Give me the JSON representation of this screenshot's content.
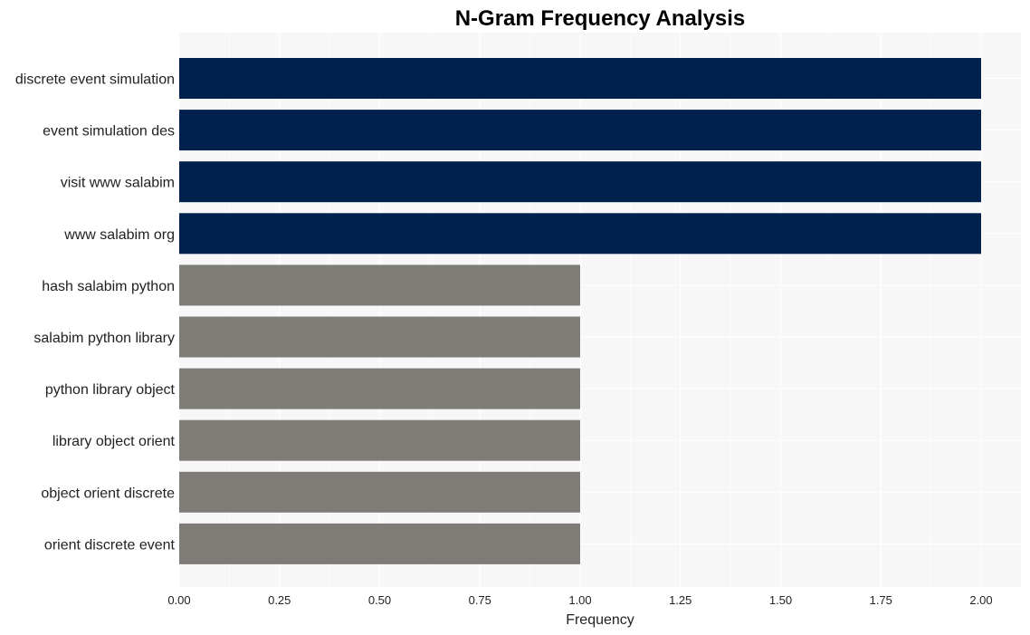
{
  "chart_data": {
    "type": "bar",
    "orientation": "horizontal",
    "title": "N-Gram Frequency Analysis",
    "xlabel": "Frequency",
    "ylabel": "",
    "categories": [
      "discrete event simulation",
      "event simulation des",
      "visit www salabim",
      "www salabim org",
      "hash salabim python",
      "salabim python library",
      "python library object",
      "library object orient",
      "object orient discrete",
      "orient discrete event"
    ],
    "values": [
      2,
      2,
      2,
      2,
      1,
      1,
      1,
      1,
      1,
      1
    ],
    "xlim": [
      0,
      2.1
    ],
    "xticks": [
      0,
      0.25,
      0.5,
      0.75,
      1.0,
      1.25,
      1.5,
      1.75,
      2.0
    ],
    "xtick_labels": [
      "0.00",
      "0.25",
      "0.50",
      "0.75",
      "1.00",
      "1.25",
      "1.50",
      "1.75",
      "2.00"
    ],
    "grid": true,
    "colors": {
      "top": "#00214e",
      "other": "#7f7c78",
      "plot_background": "#f7f7f7",
      "grid": "#ffffff"
    }
  }
}
